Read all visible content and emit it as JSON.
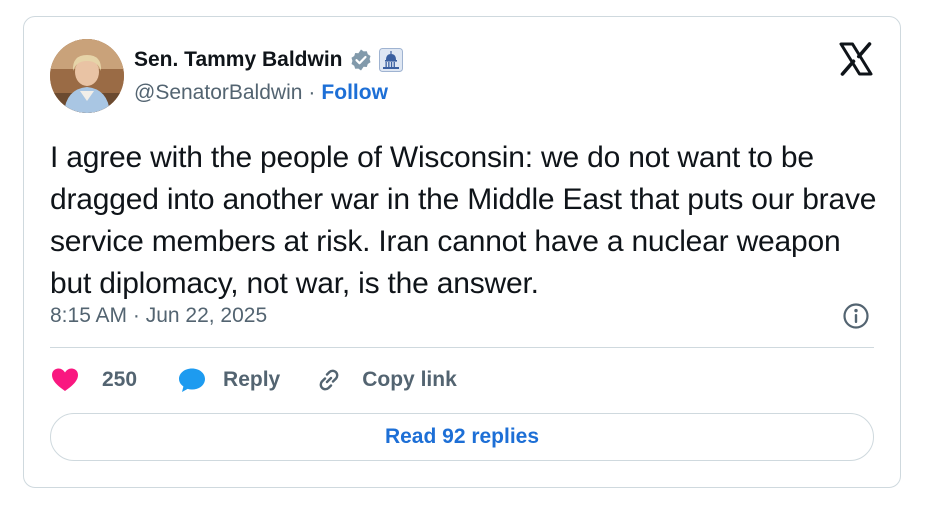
{
  "author": {
    "display_name": "Sen. Tammy Baldwin",
    "handle": "@SenatorBaldwin",
    "separator": "·",
    "follow_label": "Follow"
  },
  "tweet": {
    "text": "I agree with the people of Wisconsin: we do not want to be dragged into another war in the Middle East that puts our brave service members at risk. Iran cannot have a nuclear weapon but diplomacy, not war, is the answer.",
    "timestamp": "8:15 AM · Jun 22, 2025"
  },
  "actions": {
    "like_count": "250",
    "reply_label": "Reply",
    "copy_link_label": "Copy link"
  },
  "replies_button": "Read 92 replies",
  "icons": {
    "verified": "verified-badge-icon",
    "affiliation": "capitol-badge-icon",
    "logo": "x-logo-icon",
    "info": "info-icon",
    "like": "heart-icon",
    "reply": "speech-bubble-icon",
    "copy": "link-icon"
  },
  "colors": {
    "accent": "#1d6fd6",
    "heart": "#f91880",
    "muted": "#536471",
    "verified": "#829aab"
  }
}
